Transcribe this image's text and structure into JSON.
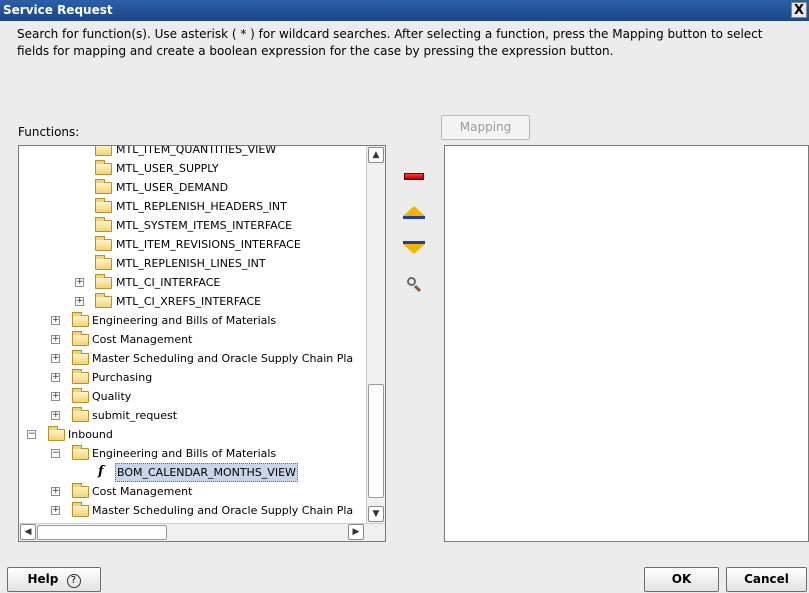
{
  "window": {
    "title": "Service Request",
    "close_label": "X"
  },
  "instructions": "Search for function(s). Use asterisk ( * ) for wildcard searches. After selecting a function, press the Mapping button to select fields for mapping and create a boolean expression for the case by pressing the expression button.",
  "functions_label": "Functions:",
  "mapping_button": "Mapping",
  "tree": {
    "rows": [
      {
        "label": "MTL_ITEM_QUANTITIES_VIEW",
        "icon": "folder-icon",
        "expander": ""
      },
      {
        "label": "MTL_USER_SUPPLY",
        "icon": "folder-icon",
        "expander": ""
      },
      {
        "label": "MTL_USER_DEMAND",
        "icon": "folder-icon",
        "expander": ""
      },
      {
        "label": "MTL_REPLENISH_HEADERS_INT",
        "icon": "folder-icon",
        "expander": ""
      },
      {
        "label": "MTL_SYSTEM_ITEMS_INTERFACE",
        "icon": "folder-icon",
        "expander": ""
      },
      {
        "label": "MTL_ITEM_REVISIONS_INTERFACE",
        "icon": "folder-icon",
        "expander": ""
      },
      {
        "label": "MTL_REPLENISH_LINES_INT",
        "icon": "folder-icon",
        "expander": ""
      },
      {
        "label": "MTL_CI_INTERFACE",
        "icon": "folder-icon",
        "expander": "+"
      },
      {
        "label": "MTL_CI_XREFS_INTERFACE",
        "icon": "folder-icon",
        "expander": "+"
      },
      {
        "label": "Engineering and Bills of Materials",
        "icon": "folder-icon",
        "expander": "+"
      },
      {
        "label": "Cost Management",
        "icon": "folder-icon",
        "expander": "+"
      },
      {
        "label": "Master Scheduling and Oracle Supply Chain Pla",
        "icon": "folder-icon",
        "expander": "+"
      },
      {
        "label": "Purchasing",
        "icon": "folder-icon",
        "expander": "+"
      },
      {
        "label": "Quality",
        "icon": "folder-icon",
        "expander": "+"
      },
      {
        "label": "submit_request",
        "icon": "folder-icon",
        "expander": "+"
      },
      {
        "label": "Inbound",
        "icon": "folder-open-icon",
        "expander": "−"
      },
      {
        "label": "Engineering and Bills of Materials",
        "icon": "folder-open-icon",
        "expander": "−"
      },
      {
        "label": "BOM_CALENDAR_MONTHS_VIEW",
        "icon": "function-icon",
        "expander": ""
      },
      {
        "label": "Cost Management",
        "icon": "folder-icon",
        "expander": "+"
      },
      {
        "label": "Master Scheduling and Oracle Supply Chain Pla",
        "icon": "folder-icon",
        "expander": "+"
      }
    ]
  },
  "side_toolbar": {
    "remove": "minus-icon",
    "move_up": "arrow-up-icon",
    "move_down": "arrow-down-icon",
    "search": "search-icon"
  },
  "footer": {
    "help_label": "Help",
    "help_icon": "?",
    "ok_label": "OK",
    "cancel_label": "Cancel"
  }
}
